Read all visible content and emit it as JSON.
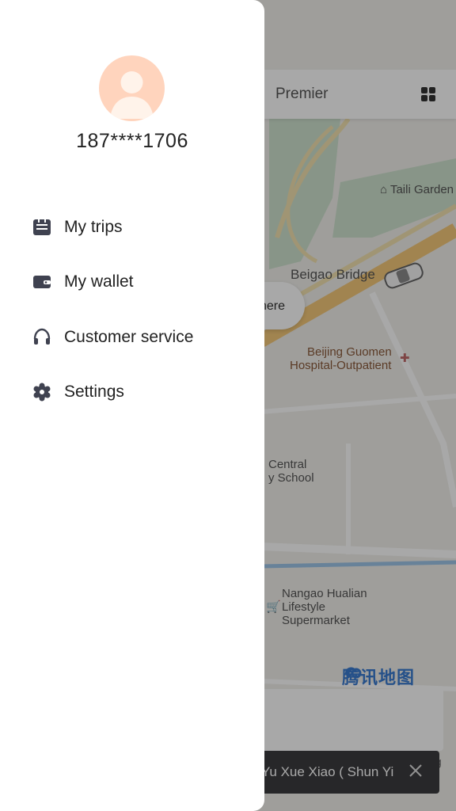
{
  "user": {
    "phone": "187****1706"
  },
  "menu": [
    {
      "id": "trips",
      "label": "My trips",
      "icon": "trips-icon"
    },
    {
      "id": "wallet",
      "label": "My wallet",
      "icon": "wallet-icon"
    },
    {
      "id": "service",
      "label": "Customer service",
      "icon": "headset-icon"
    },
    {
      "id": "settings",
      "label": "Settings",
      "icon": "gear-icon"
    }
  ],
  "background": {
    "tab_label": "Premier",
    "pill_label": "here",
    "map_labels": {
      "taili": "Taili Garden",
      "bridge": "Beigao Bridge",
      "hospital_line1": "Beijing Guomen",
      "hospital_line2": "Hospital-Outpatient",
      "school_line1": "Central",
      "school_line2": "y School",
      "market_line1": "Nangao Hualian",
      "market_line2": "Lifestyle",
      "market_line3": "Supermarket"
    },
    "brand": "腾讯地图",
    "toast_text": "Yu Xue Xiao ( Shun Yi",
    "toast_tail": "ig"
  },
  "colors": {
    "accent": "#3b7bd1",
    "scrim": "rgba(0,0,0,0.34)",
    "drawer": "#ffffff"
  }
}
